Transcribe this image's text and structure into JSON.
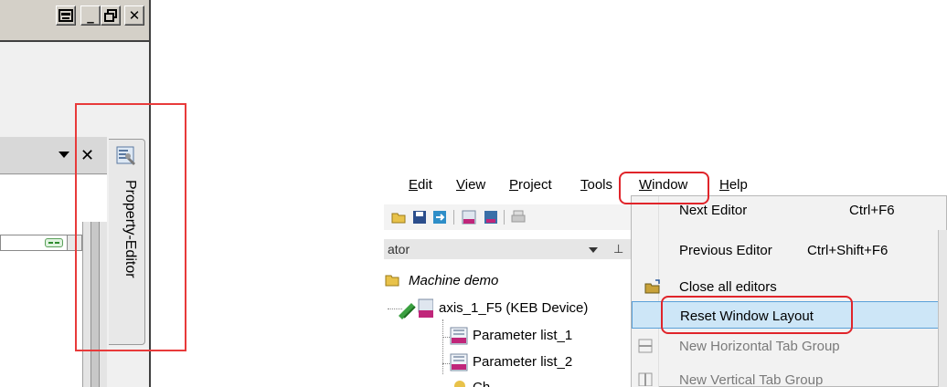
{
  "left_panel": {
    "window_buttons": [
      {
        "name": "restore-icon",
        "glyph": "▣"
      },
      {
        "name": "minimize-icon",
        "glyph": "_"
      },
      {
        "name": "maximize-icon",
        "glyph": "▫"
      },
      {
        "name": "close-icon",
        "glyph": "✕"
      }
    ],
    "panel_dropdown_glyph": "▼",
    "panel_close_glyph": "✕",
    "side_tab_label": "Property-Editor",
    "highlight_color": "#e83a3a"
  },
  "right_panel": {
    "menubar": {
      "items": [
        {
          "label": "Edit",
          "mnemonic": "E"
        },
        {
          "label": "View",
          "mnemonic": "V"
        },
        {
          "label": "Project",
          "mnemonic": "P"
        },
        {
          "label": "Tools",
          "mnemonic": "T"
        },
        {
          "label": "Window",
          "mnemonic": "W"
        },
        {
          "label": "Help",
          "mnemonic": "H"
        }
      ]
    },
    "navigator": {
      "title": "ator",
      "pin_glyph": "⊥",
      "tree": [
        {
          "label": "Machine demo",
          "italic": true
        },
        {
          "label": "axis_1_F5 (KEB Device)",
          "italic": false
        },
        {
          "label": "Parameter list_1",
          "italic": false
        },
        {
          "label": "Parameter list_2",
          "italic": false
        },
        {
          "label": "Ch...",
          "italic": false
        }
      ]
    },
    "window_menu": {
      "items": [
        {
          "label": "Next Editor",
          "shortcut": "Ctrl+F6",
          "enabled": true,
          "highlighted": false
        },
        {
          "label": "Previous Editor",
          "shortcut": "Ctrl+Shift+F6",
          "enabled": true,
          "highlighted": false
        },
        {
          "label": "Close all editors",
          "shortcut": "",
          "enabled": true,
          "highlighted": false
        },
        {
          "label": "Reset Window Layout",
          "shortcut": "",
          "enabled": true,
          "highlighted": true
        },
        {
          "label": "New Horizontal Tab Group",
          "shortcut": "",
          "enabled": false,
          "highlighted": false
        },
        {
          "label": "New Vertical Tab Group",
          "shortcut": "",
          "enabled": false,
          "highlighted": false
        }
      ]
    },
    "highlight_color": "#e0242a",
    "selection_color": "#cde6f7"
  }
}
